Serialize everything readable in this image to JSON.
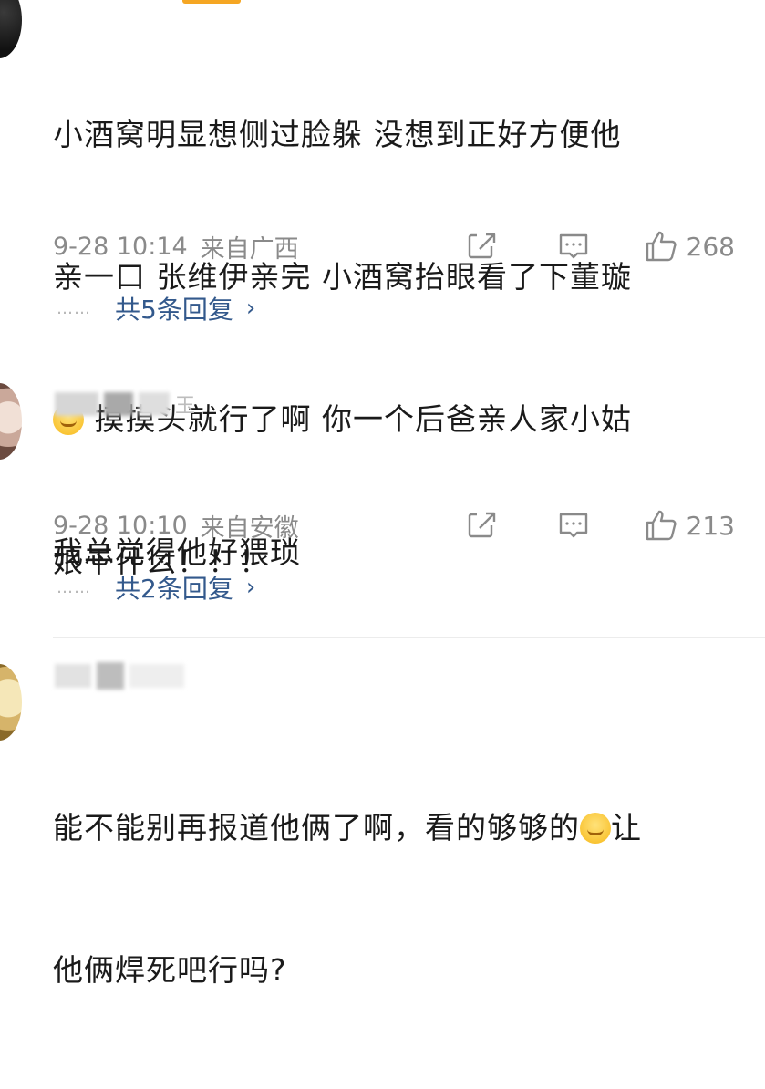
{
  "comments": [
    {
      "username": "",
      "text_line1": "小酒窝明显想侧过脸躲 没想到正好方便他",
      "text_line2": "亲一口 张维伊亲完 小酒窝抬眼看了下董璇",
      "text_line3_after_emoji": " 摸摸头就行了啊 你一个后爸亲人家小姑",
      "text_line4": "娘干什么！！！",
      "time": "9-28 10:14",
      "location": "来自广西",
      "likes": "268",
      "replies_label": "共5条回复"
    },
    {
      "username_visible": "玉",
      "text_line1": "我总觉得他好猥琐",
      "time": "9-28 10:10",
      "location": "来自安徽",
      "likes": "213",
      "replies_label": "共2条回复"
    },
    {
      "text_line1_before_emoji": "能不能别再报道他俩了啊，看的够够的",
      "text_line1_after_emoji": "让",
      "text_line2": "他俩焊死吧行吗?"
    }
  ],
  "icons": {
    "share": "share-icon",
    "comment": "comment-icon",
    "like": "thumbs-up-icon",
    "chevron": "chevron-right-icon",
    "emoji_smile": "smile-emoji-icon",
    "emoji_laugh_cry": "laugh-cry-emoji-icon"
  },
  "colors": {
    "link": "#33598c",
    "meta": "#8a8a8a",
    "text": "#1a1a1a",
    "accent": "#f5a623"
  },
  "ui": {
    "dots": "……",
    "chevron_glyph": "›"
  }
}
